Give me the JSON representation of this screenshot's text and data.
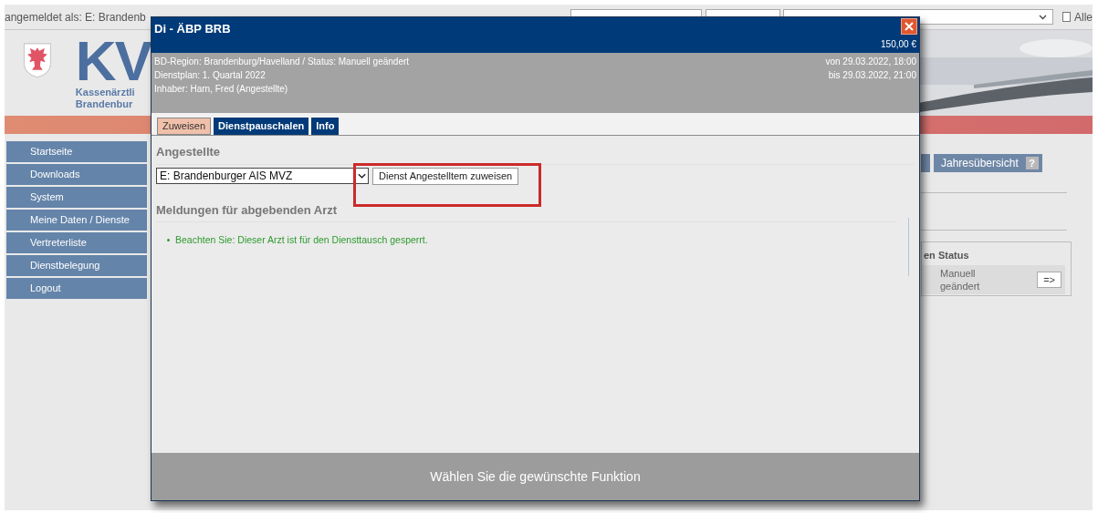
{
  "page": {
    "login_text": "angemeldet als: E: Brandenb",
    "filter_checkbox": {
      "label": "Alle",
      "checked": false
    },
    "logo": {
      "letters": "KV",
      "line_1": "Kassenärztli",
      "line_2": "Brandenbur"
    },
    "sidebar": {
      "items": [
        "Startseite",
        "Downloads",
        "System",
        "Meine Daten / Dienste",
        "Vertreterliste",
        "Dienstbelegung",
        "Logout"
      ]
    },
    "overview_button": "Jahresübersicht",
    "help_mark": "?",
    "status_panel": {
      "heading": "en Status",
      "value": "Manuell geändert",
      "go_button": "=>"
    }
  },
  "dialog": {
    "title": "Di - ÄBP BRB",
    "amount": "150,00 €",
    "info_lines": [
      "BD-Region: Brandenburg/Havelland / Status: Manuell geändert",
      "Dienstplan: 1. Quartal 2022",
      "Inhaber: Harn, Fred (Angestellte)"
    ],
    "time_lines": [
      "von 29.03.2022, 18:00",
      "bis 29.03.2022, 21:00"
    ],
    "tabs": [
      {
        "label": "Zuweisen",
        "selected": true
      },
      {
        "label": "Dienstpauschalen",
        "selected": false
      },
      {
        "label": "Info",
        "selected": false
      }
    ],
    "section_title": "Angestellte",
    "employee_select": {
      "value": "E: Brandenburger AIS MVZ"
    },
    "assign_button": "Dienst Angestelltem zuweisen",
    "messages_title": "Meldungen für abgebenden Arzt",
    "messages": [
      "Beachten Sie: Dieser Arzt ist für den Diensttausch gesperrt."
    ],
    "footer": "Wählen Sie die gewünschte Funktion"
  }
}
